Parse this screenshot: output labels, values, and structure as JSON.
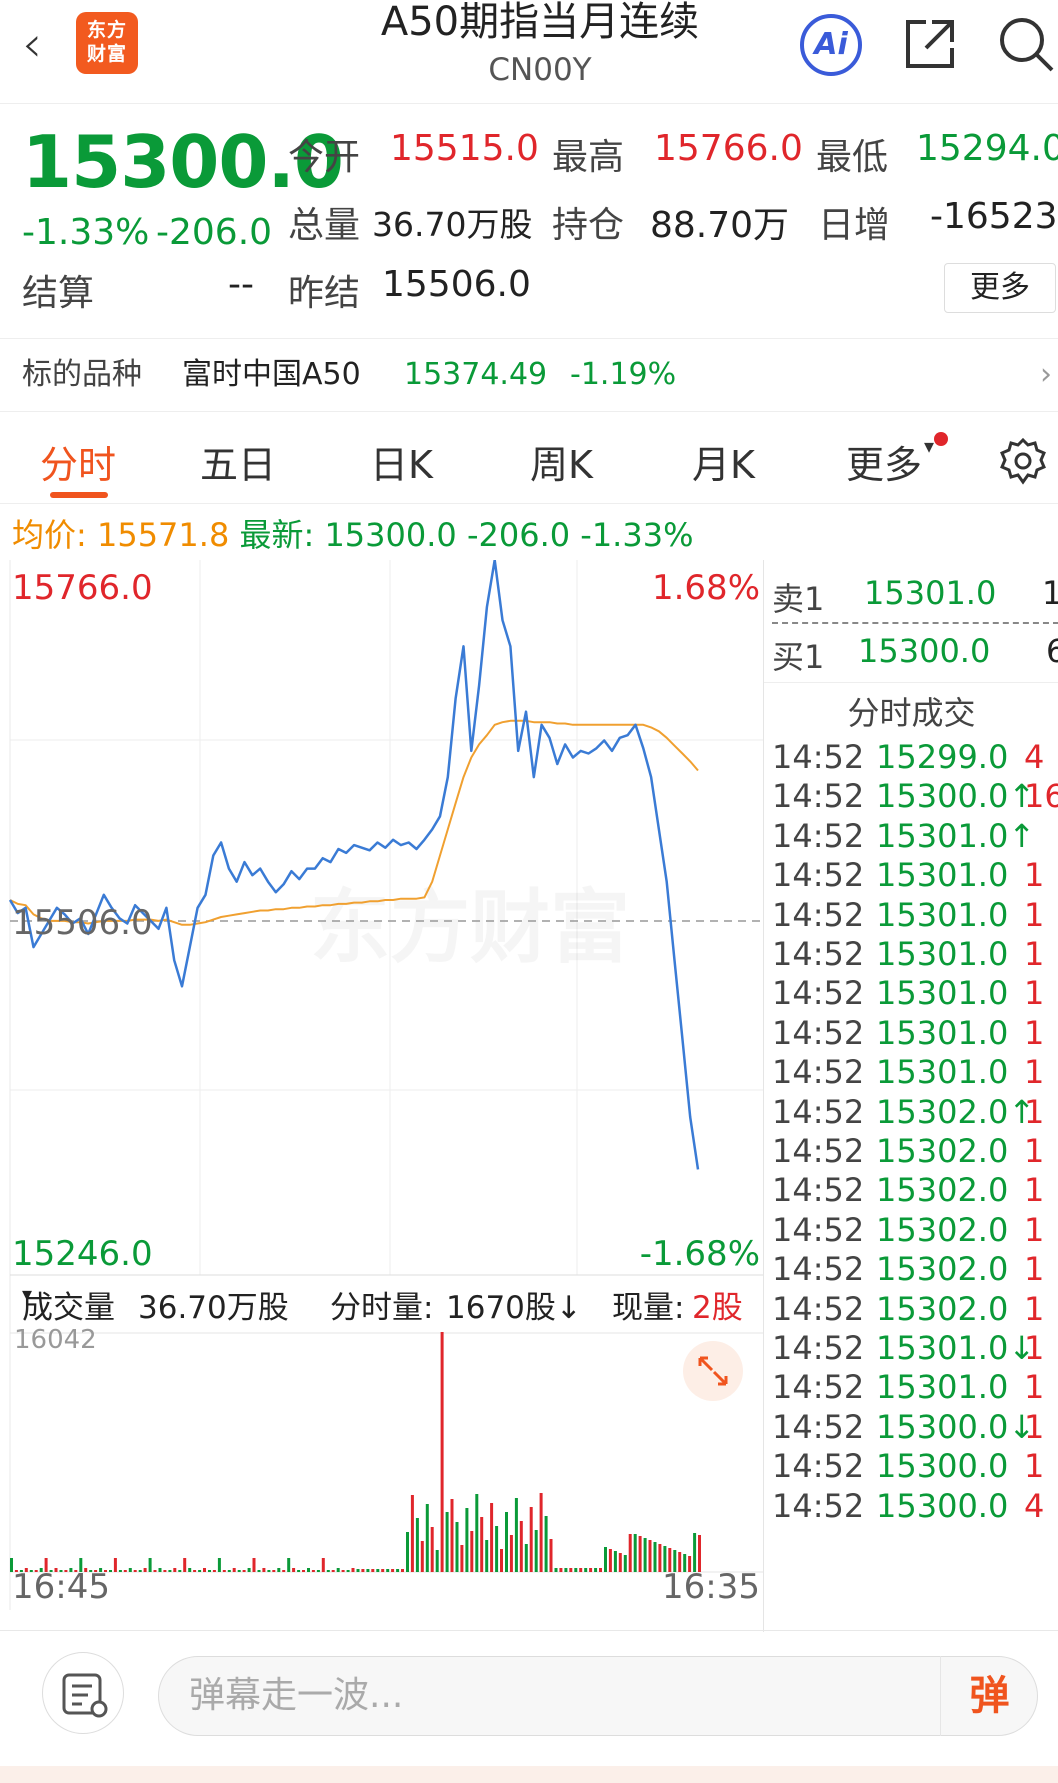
{
  "header": {
    "back_glyph": "‹",
    "logo_line1": "东方",
    "logo_line2": "财富",
    "title": "A50期指当月连续",
    "subtitle": "CN00Y",
    "ai_label": "Ai"
  },
  "quote": {
    "price": "15300.0",
    "pct": "-1.33%",
    "chg": "-206.0",
    "open_label": "今开",
    "open": "15515.0",
    "high_label": "最高",
    "high": "15766.0",
    "low_label": "最低",
    "low": "15294.0",
    "volume_label": "总量",
    "volume": "36.70万股",
    "oi_label": "持仓",
    "oi": "88.70万",
    "daily_inc_label": "日增",
    "daily_inc": "-16523",
    "settle_label": "结算",
    "settle": "--",
    "prev_settle_label": "昨结",
    "prev_settle": "15506.0",
    "more_label": "更多"
  },
  "underlying": {
    "label": "标的品种",
    "name": "富时中国A50",
    "price": "15374.49",
    "pct": "-1.19%",
    "arrow": "›"
  },
  "tabs": [
    "分时",
    "五日",
    "日K",
    "周K",
    "月K",
    "更多"
  ],
  "active_tab": 0,
  "avg_line": {
    "avg_label": "均价:",
    "avg": "15571.8",
    "last_label": "最新:",
    "last": "15300.0",
    "chg": "-206.0",
    "pct": "-1.33%"
  },
  "chart_data": {
    "type": "line",
    "y_top_label": "15766.0",
    "y_mid_label": "15506.0",
    "y_bottom_label": "15246.0",
    "pct_top_label": "1.68%",
    "pct_bottom_label": "-1.68%",
    "x_start_label": "16:45",
    "x_end_label": "16:35",
    "ylim": [
      15246.0,
      15766.0
    ],
    "reference": 15506.0,
    "price_series": [
      15506,
      15496,
      15500,
      15470,
      15480,
      15490,
      15500,
      15495,
      15488,
      15492,
      15480,
      15495,
      15510,
      15500,
      15492,
      15488,
      15502,
      15496,
      15490,
      15484,
      15500,
      15460,
      15440,
      15470,
      15500,
      15510,
      15540,
      15550,
      15530,
      15520,
      15535,
      15525,
      15530,
      15520,
      15512,
      15518,
      15528,
      15522,
      15530,
      15530,
      15538,
      15535,
      15545,
      15542,
      15548,
      15546,
      15544,
      15550,
      15546,
      15552,
      15548,
      15550,
      15545,
      15552,
      15560,
      15570,
      15600,
      15660,
      15700,
      15620,
      15670,
      15730,
      15766,
      15720,
      15700,
      15620,
      15650,
      15600,
      15640,
      15630,
      15610,
      15625,
      15615,
      15620,
      15618,
      15622,
      15628,
      15620,
      15630,
      15632,
      15640,
      15622,
      15600,
      15560,
      15520,
      15460,
      15400,
      15340,
      15300
    ],
    "avg_series": [
      15506,
      15503,
      15502,
      15495,
      15492,
      15490,
      15490,
      15490,
      15489,
      15489,
      15488,
      15489,
      15490,
      15490,
      15490,
      15490,
      15491,
      15491,
      15491,
      15490,
      15491,
      15489,
      15487,
      15487,
      15488,
      15489,
      15491,
      15493,
      15494,
      15495,
      15496,
      15497,
      15498,
      15498,
      15499,
      15499,
      15500,
      15500,
      15501,
      15501,
      15502,
      15502,
      15503,
      15503,
      15504,
      15504,
      15505,
      15505,
      15506,
      15506,
      15507,
      15507,
      15507,
      15508,
      15520,
      15540,
      15560,
      15580,
      15600,
      15615,
      15625,
      15632,
      15640,
      15642,
      15643,
      15643,
      15643,
      15642,
      15642,
      15642,
      15641,
      15641,
      15640,
      15640,
      15640,
      15640,
      15640,
      15640,
      15640,
      15640,
      15640,
      15640,
      15638,
      15635,
      15630,
      15624,
      15618,
      15612,
      15605
    ],
    "volume": {
      "label": "成交量",
      "total": "36.70万股",
      "minute_label": "分时量:",
      "minute_value": "1670股↓",
      "current_label": "现量:",
      "current_value": "2股",
      "max_label": "16042"
    }
  },
  "order_book": {
    "sell1_label": "卖1",
    "sell1_price": "15301.0",
    "sell1_vol": "1",
    "buy1_label": "买1",
    "buy1_price": "15300.0",
    "buy1_vol": "6"
  },
  "ticks_title": "分时成交",
  "ticks": [
    {
      "time": "14:52",
      "price": "15299.0",
      "vol": "4"
    },
    {
      "time": "14:52",
      "price": "15300.0↑",
      "vol": "16"
    },
    {
      "time": "14:52",
      "price": "15301.0↑",
      "vol": ""
    },
    {
      "time": "14:52",
      "price": "15301.0",
      "vol": "1"
    },
    {
      "time": "14:52",
      "price": "15301.0",
      "vol": "1"
    },
    {
      "time": "14:52",
      "price": "15301.0",
      "vol": "1"
    },
    {
      "time": "14:52",
      "price": "15301.0",
      "vol": "1"
    },
    {
      "time": "14:52",
      "price": "15301.0",
      "vol": "1"
    },
    {
      "time": "14:52",
      "price": "15301.0",
      "vol": "1"
    },
    {
      "time": "14:52",
      "price": "15302.0↑",
      "vol": "1"
    },
    {
      "time": "14:52",
      "price": "15302.0",
      "vol": "1"
    },
    {
      "time": "14:52",
      "price": "15302.0",
      "vol": "1"
    },
    {
      "time": "14:52",
      "price": "15302.0",
      "vol": "1"
    },
    {
      "time": "14:52",
      "price": "15302.0",
      "vol": "1"
    },
    {
      "time": "14:52",
      "price": "15302.0",
      "vol": "1"
    },
    {
      "time": "14:52",
      "price": "15301.0↓",
      "vol": "1"
    },
    {
      "time": "14:52",
      "price": "15301.0",
      "vol": "1"
    },
    {
      "time": "14:52",
      "price": "15300.0↓",
      "vol": "1"
    },
    {
      "time": "14:52",
      "price": "15300.0",
      "vol": "1"
    },
    {
      "time": "14:52",
      "price": "15300.0",
      "vol": "4"
    }
  ],
  "bottom": {
    "placeholder": "弹幕走一波...",
    "danmu_label": "弹"
  },
  "watermark": "东方财富"
}
